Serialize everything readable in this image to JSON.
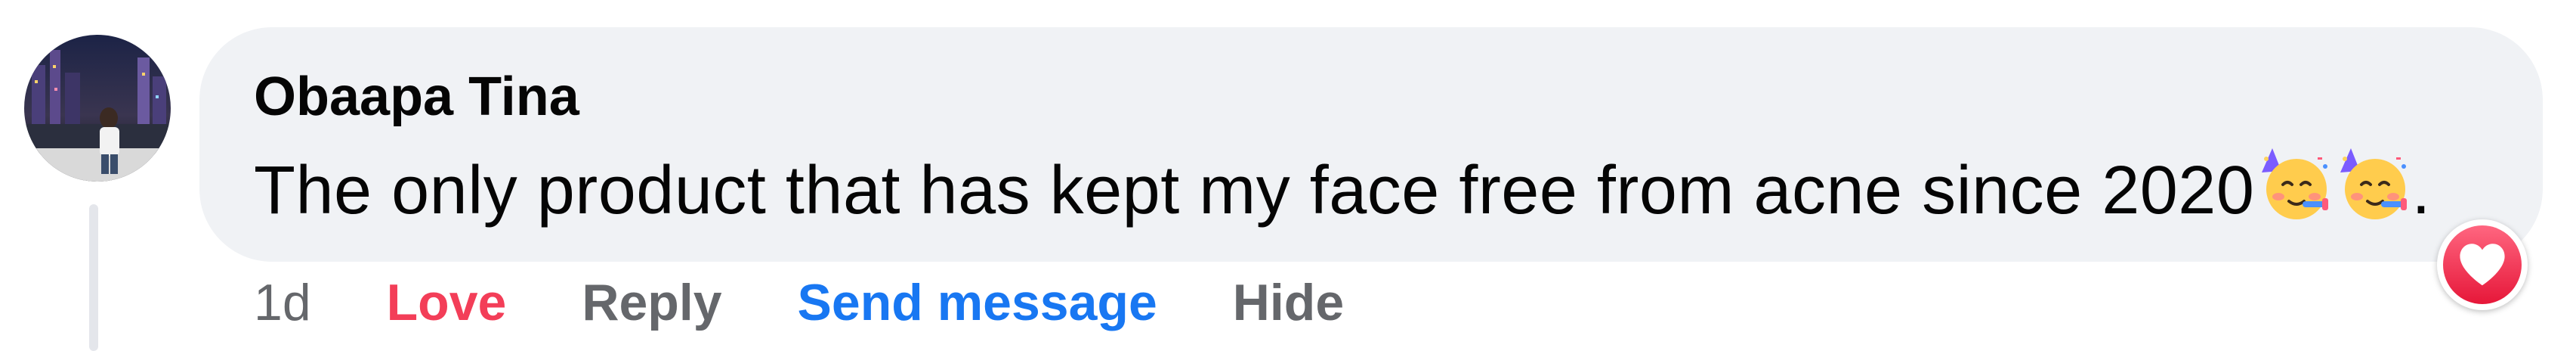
{
  "comment": {
    "author": "Obaapa Tina",
    "text": "The only product that has kept my face free from acne since 2020",
    "emojis": [
      "partying-face-emoji",
      "partying-face-emoji"
    ],
    "trailing_punctuation": ".",
    "time": "1d",
    "actions": {
      "love": "Love",
      "reply": "Reply",
      "send_message": "Send message",
      "hide": "Hide"
    },
    "reaction": "heart-icon"
  },
  "colors": {
    "bubble": "#f0f2f5",
    "love": "#f33e58",
    "link": "#1877f2",
    "secondary": "#65676b"
  }
}
